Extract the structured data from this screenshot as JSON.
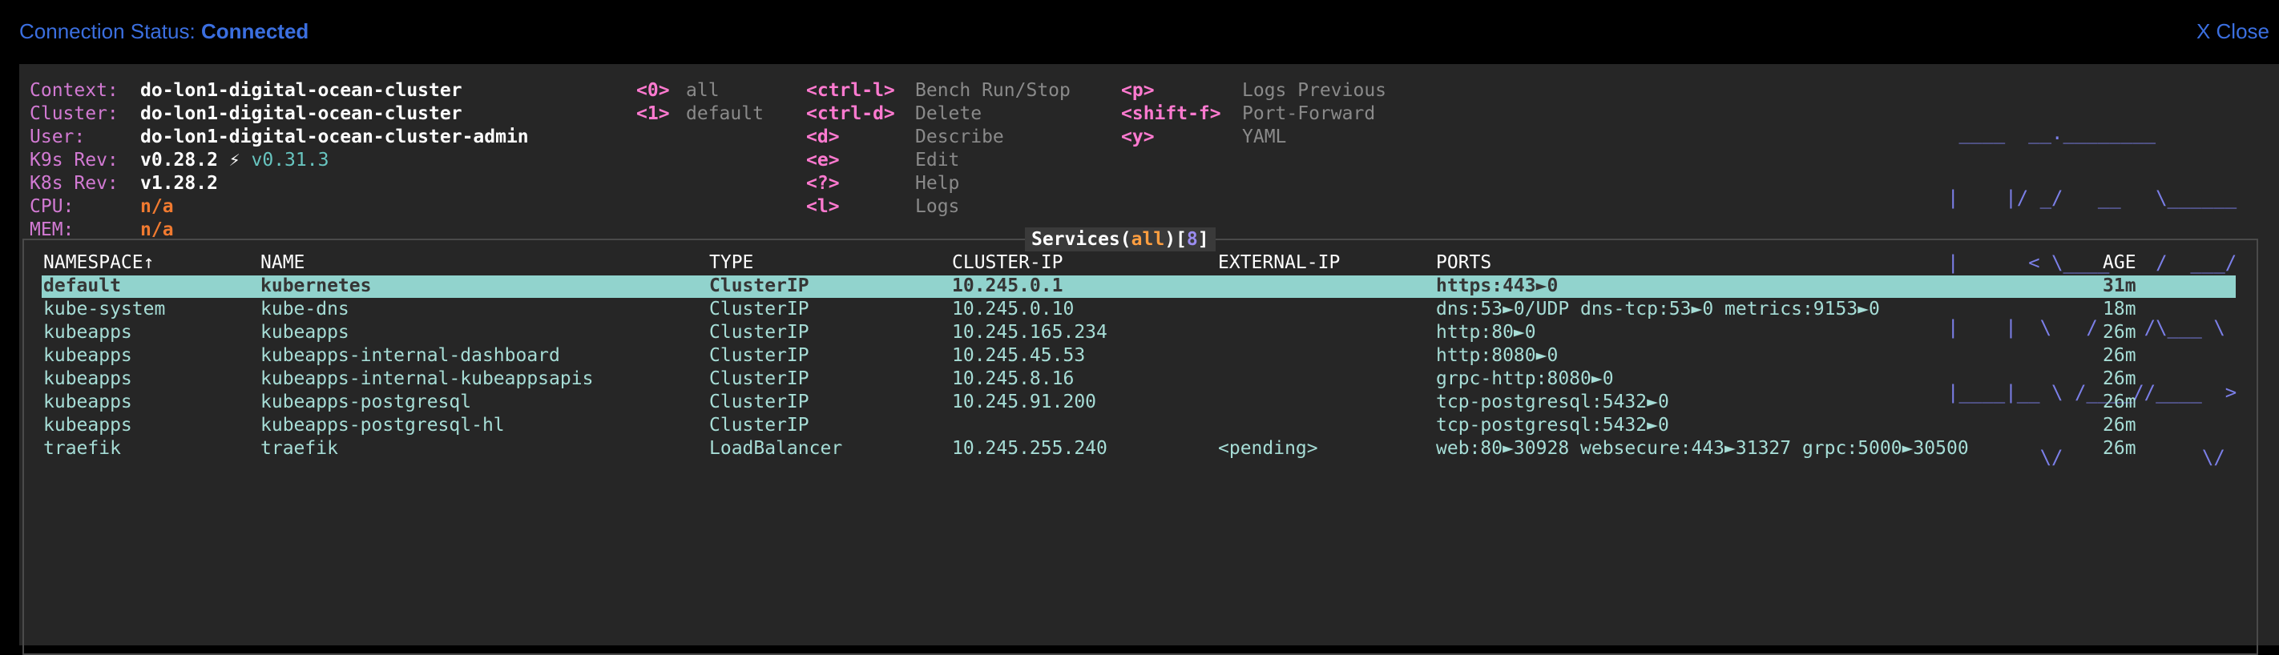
{
  "topbar": {
    "connection_label": "Connection Status:",
    "connection_value": "Connected",
    "close_label": "X Close"
  },
  "info": {
    "context_label": "Context:",
    "context_value": "do-lon1-digital-ocean-cluster",
    "cluster_label": "Cluster:",
    "cluster_value": "do-lon1-digital-ocean-cluster",
    "user_label": "User:",
    "user_value": "do-lon1-digital-ocean-cluster-admin",
    "k9s_label": "K9s Rev:",
    "k9s_value": "v0.28.2",
    "k9s_bolt": "⚡",
    "k9s_latest": "v0.31.3",
    "k8s_label": "K8s Rev:",
    "k8s_value": "v1.28.2",
    "cpu_label": "CPU:",
    "cpu_value": "n/a",
    "mem_label": "MEM:",
    "mem_value": "n/a"
  },
  "namespace_hotkeys": [
    {
      "key": "<0>",
      "desc": "all"
    },
    {
      "key": "<1>",
      "desc": "default"
    }
  ],
  "hotkeys_col1": [
    {
      "key": "<ctrl-l>",
      "desc": "Bench Run/Stop"
    },
    {
      "key": "<ctrl-d>",
      "desc": "Delete"
    },
    {
      "key": "<d>",
      "desc": "Describe"
    },
    {
      "key": "<e>",
      "desc": "Edit"
    },
    {
      "key": "<?>",
      "desc": "Help"
    },
    {
      "key": "<l>",
      "desc": "Logs"
    }
  ],
  "hotkeys_col2": [
    {
      "key": "<p>",
      "desc": "Logs Previous"
    },
    {
      "key": "<shift-f>",
      "desc": "Port-Forward"
    },
    {
      "key": "<y>",
      "desc": "YAML"
    }
  ],
  "logo": {
    "lines": [
      " ____  __.________       ",
      "|    |/ _/   __   \\______",
      "|      < \\____    /  ___/",
      "|    |  \\   /    /\\___ \\ ",
      "|____|__ \\ /____//____  >",
      "        \\/            \\/ "
    ]
  },
  "table": {
    "title_resource": "Services",
    "title_scope": "all",
    "title_count": "8",
    "columns": [
      "NAMESPACE↑",
      "NAME",
      "TYPE",
      "CLUSTER-IP",
      "EXTERNAL-IP",
      "PORTS",
      "AGE"
    ],
    "rows": [
      [
        "default",
        "kubernetes",
        "ClusterIP",
        "10.245.0.1",
        "",
        "https:443►0",
        "31m"
      ],
      [
        "kube-system",
        "kube-dns",
        "ClusterIP",
        "10.245.0.10",
        "",
        "dns:53►0/UDP dns-tcp:53►0 metrics:9153►0",
        "18m"
      ],
      [
        "kubeapps",
        "kubeapps",
        "ClusterIP",
        "10.245.165.234",
        "",
        "http:80►0",
        "26m"
      ],
      [
        "kubeapps",
        "kubeapps-internal-dashboard",
        "ClusterIP",
        "10.245.45.53",
        "",
        "http:8080►0",
        "26m"
      ],
      [
        "kubeapps",
        "kubeapps-internal-kubeappsapis",
        "ClusterIP",
        "10.245.8.16",
        "",
        "grpc-http:8080►0",
        "26m"
      ],
      [
        "kubeapps",
        "kubeapps-postgresql",
        "ClusterIP",
        "10.245.91.200",
        "",
        "tcp-postgresql:5432►0",
        "26m"
      ],
      [
        "kubeapps",
        "kubeapps-postgresql-hl",
        "ClusterIP",
        "",
        "",
        "tcp-postgresql:5432►0",
        "26m"
      ],
      [
        "traefik",
        "traefik",
        "LoadBalancer",
        "10.245.255.240",
        "<pending>",
        "web:80►30928 websecure:443►31327 grpc:5000►30500",
        "26m"
      ]
    ],
    "selected_row": 0
  },
  "colors": {
    "accent": "#3b6fe0",
    "label": "#d27ad3",
    "hotkey": "#ff7ad0",
    "row_text": "#a6ddd6",
    "selection": "#91d3cd",
    "logo": "#7b7fe8"
  }
}
